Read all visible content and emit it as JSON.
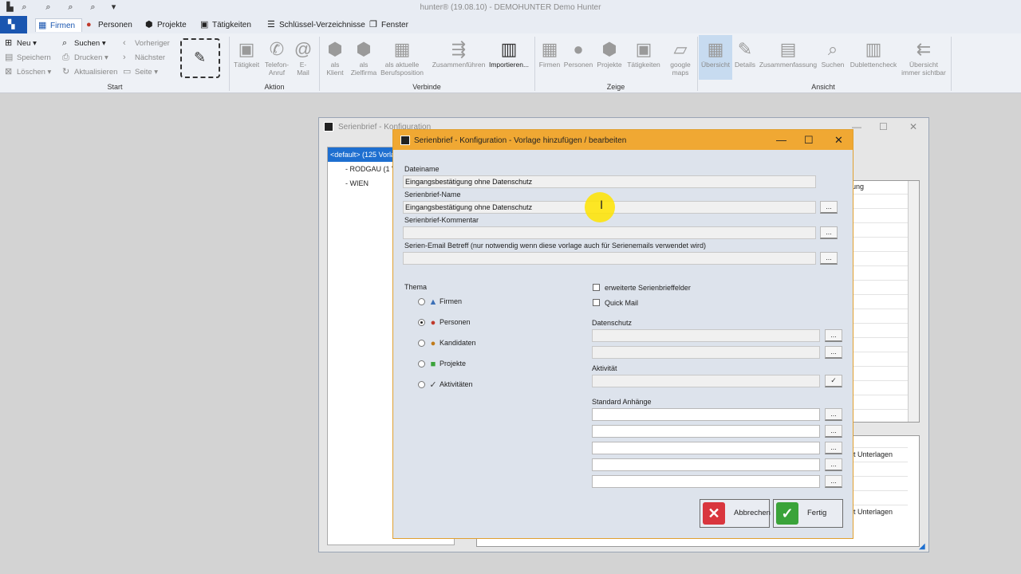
{
  "app": {
    "title": "hunter® (19.08.10) - DEMOHUNTER Demo Hunter",
    "quick_access_icons": [
      "app-logo-icon",
      "search-icon",
      "search-icon",
      "search-icon",
      "search-icon",
      "dropdown-icon"
    ]
  },
  "menu": {
    "items": [
      {
        "label": "Firmen",
        "icon": "building-icon",
        "active": true
      },
      {
        "label": "Personen",
        "icon": "person-icon",
        "active": false
      },
      {
        "label": "Projekte",
        "icon": "box-icon",
        "active": false
      },
      {
        "label": "Tätigkeiten",
        "icon": "calendar-icon",
        "active": false
      },
      {
        "label": "Schlüssel-Verzeichnisse",
        "icon": "list-icon",
        "active": false
      },
      {
        "label": "Fenster",
        "icon": "windows-icon",
        "active": false
      }
    ]
  },
  "ribbon": {
    "start": {
      "label": "Start",
      "neu": "Neu",
      "speichern": "Speichern",
      "loeschen": "Löschen",
      "suchen": "Suchen",
      "drucken": "Drucken",
      "aktualisieren": "Aktualisieren",
      "vorheriger": "Vorheriger",
      "naechster": "Nächster",
      "seite": "Seite"
    },
    "aktion": {
      "label": "Aktion",
      "taetigkeit": "Tätigkeit",
      "telefon": "Telefon-\nAnruf",
      "email": "E-\nMail"
    },
    "verbinde": {
      "label": "Verbinde",
      "klient": "als\nKlient",
      "zielfirma": "als\nZielfirma",
      "berufsposition": "als aktuelle\nBerufsposition",
      "zusammenfuehren": "Zusammenführen",
      "importieren": "Importieren..."
    },
    "zeige": {
      "label": "Zeige",
      "firmen": "Firmen",
      "personen": "Personen",
      "projekte": "Projekte",
      "taetigkeiten": "Tätigkeiten",
      "googlemaps": "google\nmaps"
    },
    "ansicht": {
      "label": "Ansicht",
      "uebersicht": "Übersicht",
      "details": "Details",
      "zusammenfassung": "Zusammenfassung",
      "suchen": "Suchen",
      "dublettencheck": "Dublettencheck",
      "immer_sichtbar": "Übersicht\nimmer sichtbar"
    }
  },
  "background_window": {
    "title": "Serienbrief - Konfiguration",
    "list": [
      "<default> (125 Vorla",
      "- RODGAU (1 V",
      "- WIEN"
    ],
    "grid_header": "ung",
    "grid2_cells": [
      "it Unterlagen",
      "it Unterlagen"
    ]
  },
  "dialog": {
    "title": "Serienbrief - Konfiguration - Vorlage hinzufügen / bearbeiten",
    "dateiname_label": "Dateiname",
    "dateiname_value": "Eingangsbestätigung ohne Datenschutz",
    "name_label": "Serienbrief-Name",
    "name_value": "Eingangsbestätigung ohne Datenschutz",
    "kommentar_label": "Serienbrief-Kommentar",
    "kommentar_value": "",
    "betreff_label": "Serien-Email Betreff (nur notwendig wenn diese vorlage auch für Serienemails verwendet wird)",
    "betreff_value": "",
    "dots_label": "...",
    "thema_label": "Thema",
    "thema_options": [
      {
        "label": "Firmen",
        "icon": "building-icon",
        "selected": false
      },
      {
        "label": "Personen",
        "icon": "person-icon",
        "selected": true
      },
      {
        "label": "Kandidaten",
        "icon": "candidate-icon",
        "selected": false
      },
      {
        "label": "Projekte",
        "icon": "box-icon",
        "selected": false
      },
      {
        "label": "Aktivitäten",
        "icon": "check-icon",
        "selected": false
      }
    ],
    "erweiterte_label": "erweiterte Serienbrieffelder",
    "quickmail_label": "Quick Mail",
    "datenschutz_label": "Datenschutz",
    "aktivitaet_label": "Aktivität",
    "anhaenge_label": "Standard Anhänge",
    "abbrechen_label": "Abbrechen",
    "fertig_label": "Fertig"
  },
  "colors": {
    "dialog_title_bg": "#f0a833",
    "selection_blue": "#1e6fd0",
    "cancel_red": "#d9363e",
    "ok_green": "#3aa33a"
  }
}
